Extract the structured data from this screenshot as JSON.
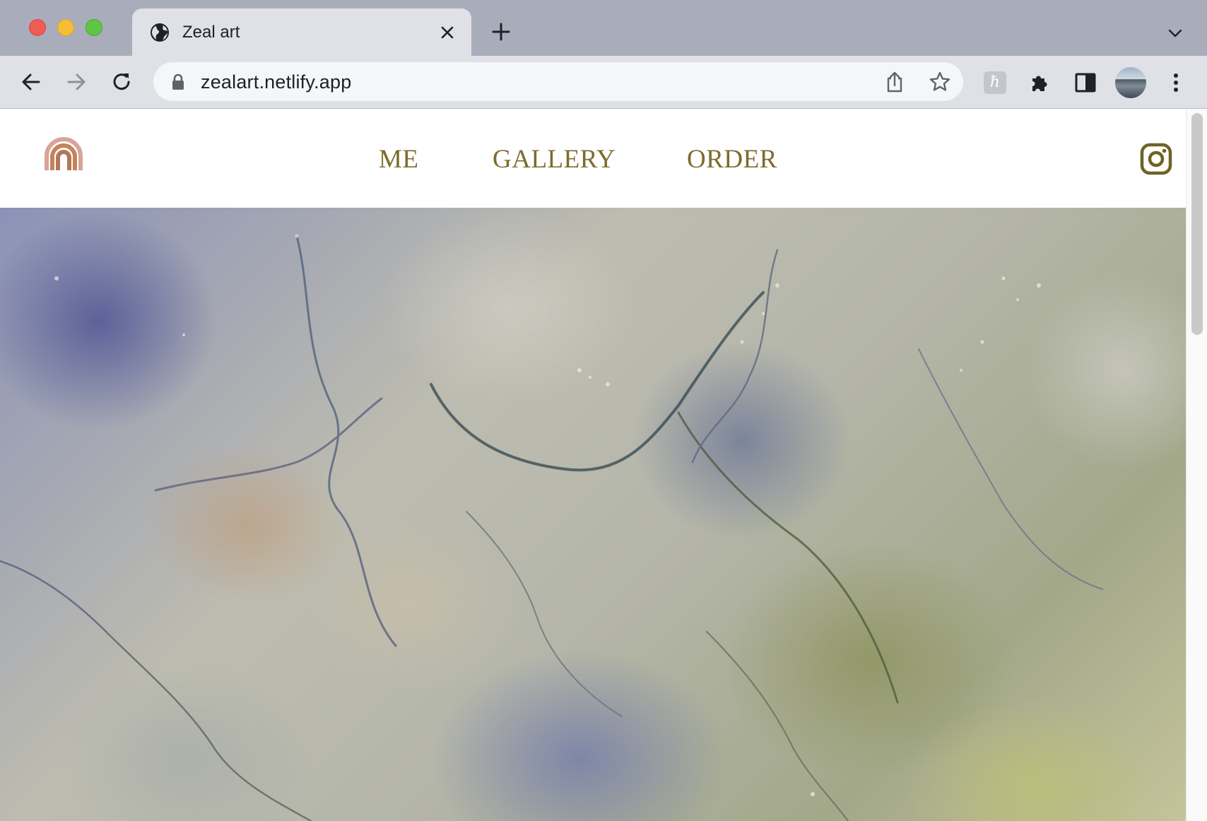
{
  "browser": {
    "tab_title": "Zeal art",
    "url": "zealart.netlify.app",
    "extension_label": "ℏ"
  },
  "site": {
    "nav": {
      "me": "ME",
      "gallery": "GALLERY",
      "order": "ORDER"
    },
    "brand_color": "#7c6c2c",
    "logo_icon": "rainbow-icon",
    "social_icon": "instagram-icon",
    "hero_image": "abstract alcohol ink painting in blue, beige and olive green"
  }
}
